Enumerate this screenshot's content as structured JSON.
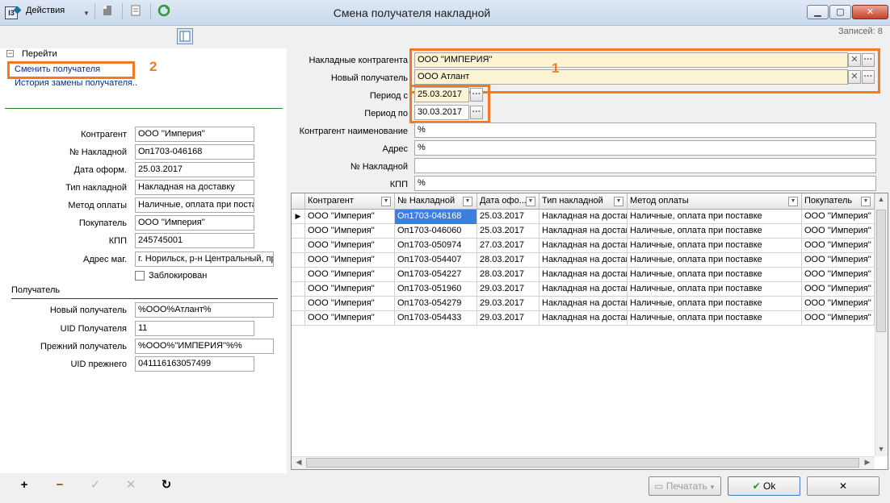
{
  "window": {
    "title": "Смена получателя накладной",
    "icon": "app-icon",
    "min": "▁",
    "max": "▢",
    "close": "✕"
  },
  "toolbar": {
    "actions_label": "Действия",
    "records_label": "Записей: 8"
  },
  "nav": {
    "header": "Перейти",
    "items": [
      "Сменить получателя",
      "История замены получателя.."
    ]
  },
  "details": {
    "fields": [
      {
        "label": "Контрагент",
        "value": "ООО ''Империя''"
      },
      {
        "label": "№ Накладной",
        "value": "Оп1703-046168"
      },
      {
        "label": "Дата оформ.",
        "value": "25.03.2017"
      },
      {
        "label": "Тип накладной",
        "value": "Накладная на доставку"
      },
      {
        "label": "Метод оплаты",
        "value": "Наличные, оплата при поставке"
      },
      {
        "label": "Покупатель",
        "value": "ООО ''Империя''"
      },
      {
        "label": "КПП",
        "value": "245745001"
      },
      {
        "label": "Адрес маг.",
        "value": "г. Норильск, р-н Центральный, пр"
      }
    ],
    "blocked_label": "Заблокирован"
  },
  "recipient": {
    "section_label": "Получатель",
    "fields": [
      {
        "label": "Новый получатель",
        "value": "%ООО%Атлант%"
      },
      {
        "label": "UID Получателя",
        "value": "11"
      },
      {
        "label": "Прежний получатель",
        "value": "%ООО%''ИМПЕРИЯ''%%"
      },
      {
        "label": "UID прежнего",
        "value": "041116163057499"
      }
    ]
  },
  "filters": {
    "invoice_contractor": {
      "label": "Накладные контрагента",
      "value": "ООО ''ИМПЕРИЯ''"
    },
    "new_recipient": {
      "label": "Новый получатель",
      "value": "ООО Атлант"
    },
    "period_from": {
      "label": "Период с",
      "value": "25.03.2017"
    },
    "period_to": {
      "label": "Период по",
      "value": "30.03.2017"
    },
    "contractor_name": {
      "label": "Контрагент наименование",
      "value": "%"
    },
    "address": {
      "label": "Адрес",
      "value": "%"
    },
    "invoice_no": {
      "label": "№ Накладной",
      "value": ""
    },
    "kpp": {
      "label": "КПП",
      "value": "%"
    }
  },
  "annotations": {
    "box1": "1",
    "box2": "2"
  },
  "grid": {
    "columns": [
      "Контрагент",
      "№ Накладной",
      "Дата офо...",
      "Тип накладной",
      "Метод оплаты",
      "Покупатель"
    ],
    "rows": [
      [
        "ООО ''Империя''",
        "Оп1703-046168",
        "25.03.2017",
        "Накладная на достав",
        "Наличные, оплата при поставке",
        "ООО ''Империя''"
      ],
      [
        "ООО ''Империя''",
        "Оп1703-046060",
        "25.03.2017",
        "Накладная на достав",
        "Наличные, оплата при поставке",
        "ООО ''Империя''"
      ],
      [
        "ООО ''Империя''",
        "Оп1703-050974",
        "27.03.2017",
        "Накладная на достав",
        "Наличные, оплата при поставке",
        "ООО ''Империя''"
      ],
      [
        "ООО ''Империя''",
        "Оп1703-054407",
        "28.03.2017",
        "Накладная на достав",
        "Наличные, оплата при поставке",
        "ООО ''Империя''"
      ],
      [
        "ООО ''Империя''",
        "Оп1703-054227",
        "28.03.2017",
        "Накладная на достав",
        "Наличные, оплата при поставке",
        "ООО ''Империя''"
      ],
      [
        "ООО ''Империя''",
        "Оп1703-051960",
        "29.03.2017",
        "Накладная на достав",
        "Наличные, оплата при поставке",
        "ООО ''Империя''"
      ],
      [
        "ООО ''Империя''",
        "Оп1703-054279",
        "29.03.2017",
        "Накладная на достав",
        "Наличные, оплата при поставке",
        "ООО ''Империя''"
      ],
      [
        "ООО ''Империя''",
        "Оп1703-054433",
        "29.03.2017",
        "Накладная на достав",
        "Наличные, оплата при поставке",
        "ООО ''Империя''"
      ]
    ]
  },
  "buttons": {
    "print": "Печатать",
    "ok": "Ok",
    "cancel": "✕"
  },
  "colors": {
    "accent": "#f37a20",
    "selection": "#3d7ee0",
    "highlight_field": "#fdf4d4"
  }
}
